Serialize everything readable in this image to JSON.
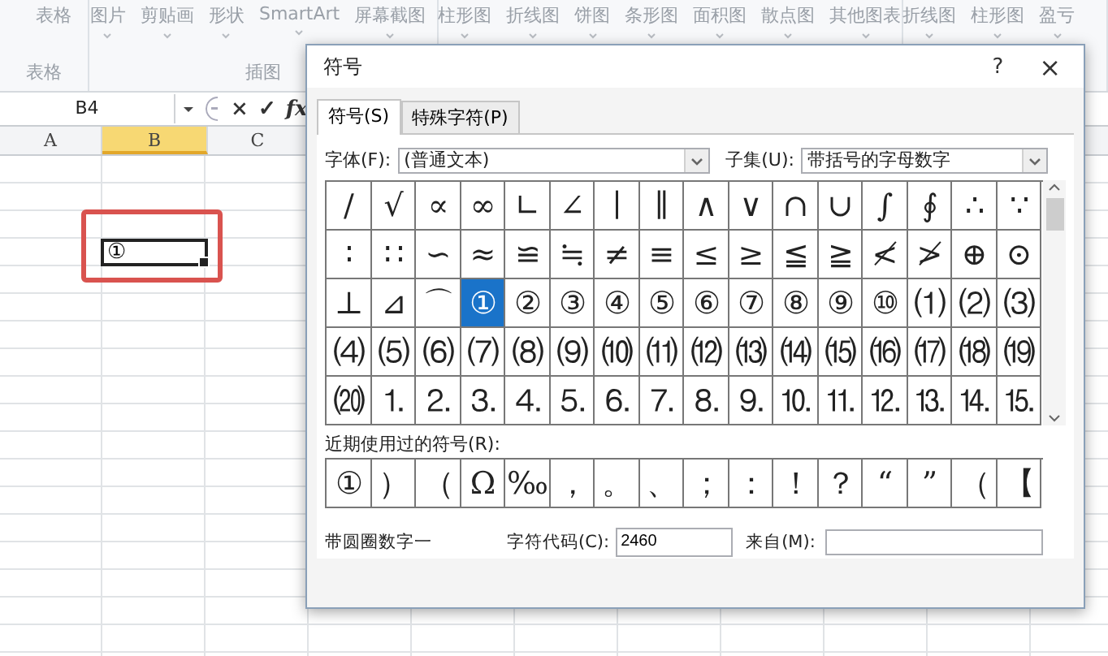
{
  "ribbon": {
    "groups": [
      {
        "commands": [
          "表格"
        ],
        "label": "表格"
      },
      {
        "commands": [
          "图片",
          "剪贴画",
          "形状",
          "SmartArt",
          "屏幕截图"
        ],
        "label": "插图"
      },
      {
        "commands": [
          "柱形图",
          "折线图",
          "饼图",
          "条形图",
          "面积图",
          "散点图",
          "其他图表"
        ]
      },
      {
        "commands": [
          "折线图",
          "柱形图",
          "盈亏"
        ]
      }
    ]
  },
  "formula_bar": {
    "name_box": "B4",
    "buttons": [
      "×",
      "✓",
      "fx"
    ]
  },
  "sheet": {
    "columns": [
      {
        "label": "A",
        "selected": false
      },
      {
        "label": "B",
        "selected": true
      },
      {
        "label": "C",
        "selected": false
      }
    ],
    "active_cell_value": "①"
  },
  "dialog": {
    "title": "符号",
    "help": "?",
    "close": "×",
    "tabs": [
      {
        "label": "符号(S)",
        "selected": true
      },
      {
        "label": "特殊字符(P)",
        "selected": false
      }
    ],
    "font_label": "字体(F):",
    "font_value": "(普通文本)",
    "subset_label": "子集(U):",
    "subset_value": "带括号的字母数字",
    "symbols": [
      {
        "char": "/",
        "selected": false
      },
      {
        "char": "√",
        "selected": false
      },
      {
        "char": "∝",
        "selected": false
      },
      {
        "char": "∞",
        "selected": false
      },
      {
        "char": "∟",
        "selected": false
      },
      {
        "char": "∠",
        "selected": false
      },
      {
        "char": "∣",
        "selected": false
      },
      {
        "char": "∥",
        "selected": false
      },
      {
        "char": "∧",
        "selected": false
      },
      {
        "char": "∨",
        "selected": false
      },
      {
        "char": "∩",
        "selected": false
      },
      {
        "char": "∪",
        "selected": false
      },
      {
        "char": "∫",
        "selected": false
      },
      {
        "char": "∮",
        "selected": false
      },
      {
        "char": "∴",
        "selected": false
      },
      {
        "char": "∵",
        "selected": false
      },
      {
        "char": "∶",
        "selected": false
      },
      {
        "char": "∷",
        "selected": false
      },
      {
        "char": "∽",
        "selected": false
      },
      {
        "char": "≈",
        "selected": false
      },
      {
        "char": "≌",
        "selected": false
      },
      {
        "char": "≒",
        "selected": false
      },
      {
        "char": "≠",
        "selected": false
      },
      {
        "char": "≡",
        "selected": false
      },
      {
        "char": "≤",
        "selected": false
      },
      {
        "char": "≥",
        "selected": false
      },
      {
        "char": "≦",
        "selected": false
      },
      {
        "char": "≧",
        "selected": false
      },
      {
        "char": "≮",
        "selected": false
      },
      {
        "char": "≯",
        "selected": false
      },
      {
        "char": "⊕",
        "selected": false
      },
      {
        "char": "⊙",
        "selected": false
      },
      {
        "char": "⊥",
        "selected": false
      },
      {
        "char": "⊿",
        "selected": false
      },
      {
        "char": "⌒",
        "selected": false
      },
      {
        "char": "①",
        "selected": true
      },
      {
        "char": "②",
        "selected": false
      },
      {
        "char": "③",
        "selected": false
      },
      {
        "char": "④",
        "selected": false
      },
      {
        "char": "⑤",
        "selected": false
      },
      {
        "char": "⑥",
        "selected": false
      },
      {
        "char": "⑦",
        "selected": false
      },
      {
        "char": "⑧",
        "selected": false
      },
      {
        "char": "⑨",
        "selected": false
      },
      {
        "char": "⑩",
        "selected": false
      },
      {
        "char": "⑴",
        "selected": false
      },
      {
        "char": "⑵",
        "selected": false
      },
      {
        "char": "⑶",
        "selected": false
      },
      {
        "char": "⑷",
        "selected": false
      },
      {
        "char": "⑸",
        "selected": false
      },
      {
        "char": "⑹",
        "selected": false
      },
      {
        "char": "⑺",
        "selected": false
      },
      {
        "char": "⑻",
        "selected": false
      },
      {
        "char": "⑼",
        "selected": false
      },
      {
        "char": "⑽",
        "selected": false
      },
      {
        "char": "⑾",
        "selected": false
      },
      {
        "char": "⑿",
        "selected": false
      },
      {
        "char": "⒀",
        "selected": false
      },
      {
        "char": "⒁",
        "selected": false
      },
      {
        "char": "⒂",
        "selected": false
      },
      {
        "char": "⒃",
        "selected": false
      },
      {
        "char": "⒄",
        "selected": false
      },
      {
        "char": "⒅",
        "selected": false
      },
      {
        "char": "⒆",
        "selected": false
      },
      {
        "char": "⒇",
        "selected": false
      },
      {
        "char": "⒈",
        "selected": false
      },
      {
        "char": "⒉",
        "selected": false
      },
      {
        "char": "⒊",
        "selected": false
      },
      {
        "char": "⒋",
        "selected": false
      },
      {
        "char": "⒌",
        "selected": false
      },
      {
        "char": "⒍",
        "selected": false
      },
      {
        "char": "⒎",
        "selected": false
      },
      {
        "char": "⒏",
        "selected": false
      },
      {
        "char": "⒐",
        "selected": false
      },
      {
        "char": "⒑",
        "selected": false
      },
      {
        "char": "⒒",
        "selected": false
      },
      {
        "char": "⒓",
        "selected": false
      },
      {
        "char": "⒔",
        "selected": false
      },
      {
        "char": "⒕",
        "selected": false
      },
      {
        "char": "⒖",
        "selected": false
      }
    ],
    "recent_label": "近期使用过的符号(R):",
    "recent": [
      "①",
      "）",
      "（",
      "Ω",
      "‰",
      "，",
      "。",
      "、",
      "；",
      "：",
      "！",
      "？",
      "“",
      "”",
      "（",
      "【"
    ],
    "char_name": "带圆圈数字一",
    "code_label": "字符代码(C):",
    "code_value": "2460",
    "from_label": "来自(M):"
  }
}
